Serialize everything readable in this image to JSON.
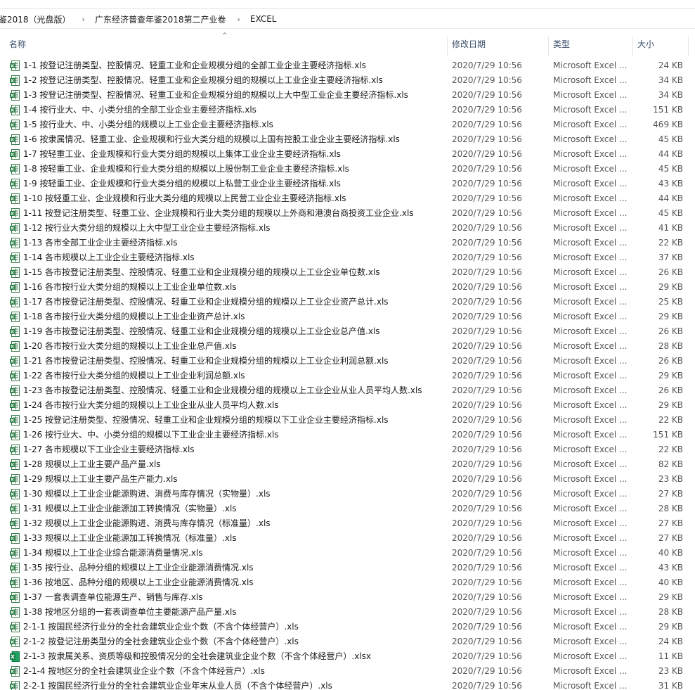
{
  "breadcrumb": [
    "鉴2018（光盘版）",
    "广东经济普查年鉴2018第二产业卷",
    "EXCEL"
  ],
  "breadcrumb_separator": "›",
  "sort_indicator": "^",
  "columns": {
    "name": "名称",
    "date": "修改日期",
    "type": "类型",
    "size": "大小"
  },
  "rows": [
    {
      "name": "1-1  按登记注册类型、控股情况、轻重工业和企业规模分组的全部工业企业主要经济指标.xls",
      "date": "2020/7/29 10:56",
      "type": "Microsoft Excel ...",
      "size": "24 KB",
      "icon": "excel-icon"
    },
    {
      "name": "1-2  按登记注册类型、控股情况、轻重工业和企业规模分组的规模以上工业企业主要经济指标.xls",
      "date": "2020/7/29 10:56",
      "type": "Microsoft Excel ...",
      "size": "34 KB",
      "icon": "excel-icon"
    },
    {
      "name": "1-3  按登记注册类型、控股情况、轻重工业和企业规模分组的规模以上大中型工业企业主要经济指标.xls",
      "date": "2020/7/29 10:56",
      "type": "Microsoft Excel ...",
      "size": "34 KB",
      "icon": "excel-icon"
    },
    {
      "name": "1-4  按行业大、中、小类分组的全部工业企业主要经济指标.xls",
      "date": "2020/7/29 10:56",
      "type": "Microsoft Excel ...",
      "size": "151 KB",
      "icon": "excel-icon"
    },
    {
      "name": "1-5  按行业大、中、小类分组的规模以上工业企业主要经济指标.xls",
      "date": "2020/7/29 10:56",
      "type": "Microsoft Excel ...",
      "size": "469 KB",
      "icon": "excel-icon"
    },
    {
      "name": "1-6  按隶属情况、轻重工业、企业规模和行业大类分组的规模以上国有控股工业企业主要经济指标.xls",
      "date": "2020/7/29 10:56",
      "type": "Microsoft Excel ...",
      "size": "45 KB",
      "icon": "excel-icon"
    },
    {
      "name": "1-7  按轻重工业、企业规模和行业大类分组的规模以上集体工业企业主要经济指标.xls",
      "date": "2020/7/29 10:56",
      "type": "Microsoft Excel ...",
      "size": "44 KB",
      "icon": "excel-icon"
    },
    {
      "name": "1-8  按轻重工业、企业规模和行业大类分组的规模以上股份制工业企业主要经济指标.xls",
      "date": "2020/7/29 10:56",
      "type": "Microsoft Excel ...",
      "size": "45 KB",
      "icon": "excel-icon"
    },
    {
      "name": "1-9  按轻重工业、企业规模和行业大类分组的规模以上私营工业企业主要经济指标.xls",
      "date": "2020/7/29 10:56",
      "type": "Microsoft Excel ...",
      "size": "43 KB",
      "icon": "excel-icon"
    },
    {
      "name": "1-10 按轻重工业、企业规模和行业大类分组的规模以上民营工业企业主要经济指标.xls",
      "date": "2020/7/29 10:56",
      "type": "Microsoft Excel ...",
      "size": "44 KB",
      "icon": "excel-icon"
    },
    {
      "name": "1-11 按登记注册类型、轻重工业、企业规模和行业大类分组的规模以上外商和港澳台商投资工业企业.xls",
      "date": "2020/7/29 10:56",
      "type": "Microsoft Excel ...",
      "size": "45 KB",
      "icon": "excel-icon"
    },
    {
      "name": "1-12 按行业大类分组的规模以上大中型工业企业主要经济指标.xls",
      "date": "2020/7/29 10:56",
      "type": "Microsoft Excel ...",
      "size": "41 KB",
      "icon": "excel-icon"
    },
    {
      "name": "1-13 各市全部工业企业主要经济指标.xls",
      "date": "2020/7/29 10:56",
      "type": "Microsoft Excel ...",
      "size": "22 KB",
      "icon": "excel-icon"
    },
    {
      "name": "1-14 各市规模以上工业企业主要经济指标.xls",
      "date": "2020/7/29 10:56",
      "type": "Microsoft Excel ...",
      "size": "37 KB",
      "icon": "excel-icon"
    },
    {
      "name": "1-15 各市按登记注册类型、控股情况、轻重工业和企业规模分组的规模以上工业企业单位数.xls",
      "date": "2020/7/29 10:56",
      "type": "Microsoft Excel ...",
      "size": "26 KB",
      "icon": "excel-icon"
    },
    {
      "name": "1-16 各市按行业大类分组的规模以上工业企业单位数.xls",
      "date": "2020/7/29 10:56",
      "type": "Microsoft Excel ...",
      "size": "29 KB",
      "icon": "excel-icon"
    },
    {
      "name": "1-17 各市按登记注册类型、控股情况、轻重工业和企业规模分组的规模以上工业企业资产总计.xls",
      "date": "2020/7/29 10:56",
      "type": "Microsoft Excel ...",
      "size": "25 KB",
      "icon": "excel-icon"
    },
    {
      "name": "1-18 各市按行业大类分组的规模以上工业企业资产总计.xls",
      "date": "2020/7/29 10:56",
      "type": "Microsoft Excel ...",
      "size": "29 KB",
      "icon": "excel-icon"
    },
    {
      "name": "1-19 各市按登记注册类型、控股情况、轻重工业和企业规模分组的规模以上工业企业总产值.xls",
      "date": "2020/7/29 10:56",
      "type": "Microsoft Excel ...",
      "size": "26 KB",
      "icon": "excel-icon"
    },
    {
      "name": "1-20 各市按行业大类分组的规模以上工业企业总产值.xls",
      "date": "2020/7/29 10:56",
      "type": "Microsoft Excel ...",
      "size": "28 KB",
      "icon": "excel-icon"
    },
    {
      "name": "1-21 各市按登记注册类型、控股情况、轻重工业和企业规模分组的规模以上工业企业利润总额.xls",
      "date": "2020/7/29 10:56",
      "type": "Microsoft Excel ...",
      "size": "26 KB",
      "icon": "excel-icon"
    },
    {
      "name": "1-22 各市按行业大类分组的规模以上工业企业利润总额.xls",
      "date": "2020/7/29 10:56",
      "type": "Microsoft Excel ...",
      "size": "29 KB",
      "icon": "excel-icon"
    },
    {
      "name": "1-23 各市按登记注册类型、控股情况、轻重工业和企业规模分组的规模以上工业企业从业人员平均人数.xls",
      "date": "2020/7/29 10:56",
      "type": "Microsoft Excel ...",
      "size": "26 KB",
      "icon": "excel-icon"
    },
    {
      "name": "1-24 各市按行业大类分组的规模以上工业企业从业人员平均人数.xls",
      "date": "2020/7/29 10:56",
      "type": "Microsoft Excel ...",
      "size": "29 KB",
      "icon": "excel-icon"
    },
    {
      "name": "1-25 按登记注册类型、控股情况、轻重工业和企业规模分组的规模以下工业企业主要经济指标.xls",
      "date": "2020/7/29 10:56",
      "type": "Microsoft Excel ...",
      "size": "22 KB",
      "icon": "excel-icon"
    },
    {
      "name": "1-26  按行业大、中、小类分组的规模以下工业企业主要经济指标.xls",
      "date": "2020/7/29 10:56",
      "type": "Microsoft Excel ...",
      "size": "151 KB",
      "icon": "excel-icon"
    },
    {
      "name": "1-27  各市规模以下工业企业主要经济指标.xls",
      "date": "2020/7/29 10:56",
      "type": "Microsoft Excel ...",
      "size": "22 KB",
      "icon": "excel-icon"
    },
    {
      "name": "1-28  规模以上工业主要产品产量.xls",
      "date": "2020/7/29 10:56",
      "type": "Microsoft Excel ...",
      "size": "82 KB",
      "icon": "excel-icon"
    },
    {
      "name": "1-29  规模以上工业主要产品生产能力.xls",
      "date": "2020/7/29 10:56",
      "type": "Microsoft Excel ...",
      "size": "23 KB",
      "icon": "excel-icon"
    },
    {
      "name": "1-30 规模以上工业企业能源购进、消费与库存情况（实物量）.xls",
      "date": "2020/7/29 10:56",
      "type": "Microsoft Excel ...",
      "size": "27 KB",
      "icon": "excel-icon"
    },
    {
      "name": "1-31 规模以上工业企业能源加工转换情况（实物量）.xls",
      "date": "2020/7/29 10:56",
      "type": "Microsoft Excel ...",
      "size": "28 KB",
      "icon": "excel-icon"
    },
    {
      "name": "1-32 规模以上工业企业能源购进、消费与库存情况（标准量）.xls",
      "date": "2020/7/29 10:56",
      "type": "Microsoft Excel ...",
      "size": "27 KB",
      "icon": "excel-icon"
    },
    {
      "name": "1-33 规模以上工业企业能源加工转换情况（标准量）.xls",
      "date": "2020/7/29 10:56",
      "type": "Microsoft Excel ...",
      "size": "27 KB",
      "icon": "excel-icon"
    },
    {
      "name": "1-34 规模以上工业企业综合能源消费量情况.xls",
      "date": "2020/7/29 10:56",
      "type": "Microsoft Excel ...",
      "size": "40 KB",
      "icon": "excel-icon"
    },
    {
      "name": "1-35 按行业、品种分组的规模以上工业企业能源消费情况.xls",
      "date": "2020/7/29 10:56",
      "type": "Microsoft Excel ...",
      "size": "43 KB",
      "icon": "excel-icon"
    },
    {
      "name": "1-36 按地区、品种分组的规模以上工业企业能源消费情况.xls",
      "date": "2020/7/29 10:56",
      "type": "Microsoft Excel ...",
      "size": "40 KB",
      "icon": "excel-icon"
    },
    {
      "name": "1-37  一套表调查单位能源生产、销售与库存.xls",
      "date": "2020/7/29 10:56",
      "type": "Microsoft Excel ...",
      "size": "29 KB",
      "icon": "excel-icon"
    },
    {
      "name": "1-38 按地区分组的一套表调查单位主要能源产品产量.xls",
      "date": "2020/7/29 10:56",
      "type": "Microsoft Excel ...",
      "size": "28 KB",
      "icon": "excel-icon"
    },
    {
      "name": "2-1-1  按国民经济行业分的全社会建筑业企业个数（不含个体经营户）.xls",
      "date": "2020/7/29 10:56",
      "type": "Microsoft Excel ...",
      "size": "29 KB",
      "icon": "excel-icon"
    },
    {
      "name": "2-1-2  按登记注册类型分的全社会建筑业企业个数（不含个体经营户）.xls",
      "date": "2020/7/29 10:56",
      "type": "Microsoft Excel ...",
      "size": "24 KB",
      "icon": "excel-icon"
    },
    {
      "name": "2-1-3  按隶属关系、资质等级和控股情况分的全社会建筑业企业个数（不含个体经营户）.xlsx",
      "date": "2020/7/29 10:56",
      "type": "Microsoft Excel ...",
      "size": "11 KB",
      "icon": "excel-x-icon"
    },
    {
      "name": "2-1-4  按地区分的全社会建筑业企业个数（不含个体经营户）.xls",
      "date": "2020/7/29 10:56",
      "type": "Microsoft Excel ...",
      "size": "23 KB",
      "icon": "excel-icon"
    },
    {
      "name": "2-2-1  按国民经济行业分的全社会建筑业企业年末从业人员（不含个体经营户）.xls",
      "date": "2020/7/29 10:56",
      "type": "Microsoft Excel ...",
      "size": "31 KB",
      "icon": "excel-icon"
    }
  ]
}
